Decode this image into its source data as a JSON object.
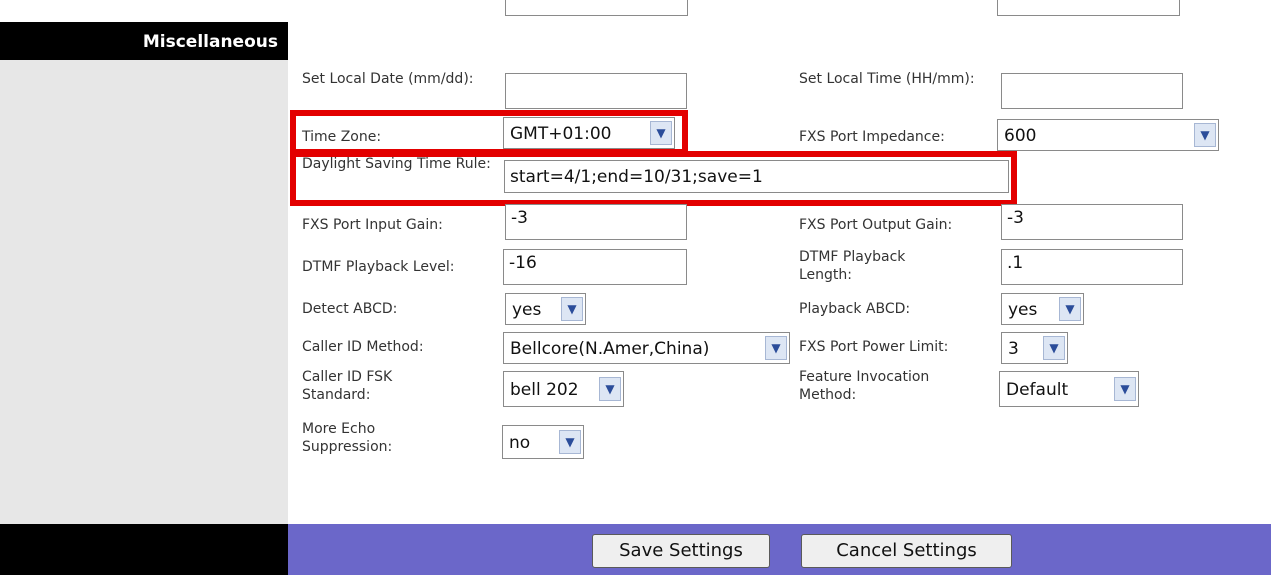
{
  "sidebar": {
    "section_title": "Miscellaneous"
  },
  "fields": {
    "set_local_date": {
      "label": "Set Local Date (mm/dd):",
      "value": ""
    },
    "set_local_time": {
      "label": "Set Local Time (HH/mm):",
      "value": ""
    },
    "time_zone": {
      "label": "Time Zone:",
      "value": "GMT+01:00"
    },
    "fxs_port_impedance": {
      "label": "FXS Port Impedance:",
      "value": "600"
    },
    "daylight_saving_time_rule": {
      "label": "Daylight Saving Time Rule:",
      "value": "start=4/1;end=10/31;save=1"
    },
    "fxs_port_input_gain": {
      "label": "FXS Port Input Gain:",
      "value": "-3"
    },
    "fxs_port_output_gain": {
      "label": "FXS Port Output Gain:",
      "value": "-3"
    },
    "dtmf_playback_level": {
      "label": "DTMF Playback Level:",
      "value": "-16"
    },
    "dtmf_playback_length": {
      "label": "DTMF Playback Length:",
      "value": ".1"
    },
    "detect_abcd": {
      "label": "Detect ABCD:",
      "value": "yes"
    },
    "playback_abcd": {
      "label": "Playback ABCD:",
      "value": "yes"
    },
    "caller_id_method": {
      "label": "Caller ID Method:",
      "value": "Bellcore(N.Amer,China)"
    },
    "fxs_port_power_limit": {
      "label": "FXS Port Power Limit:",
      "value": "3"
    },
    "caller_id_fsk_standard": {
      "label": "Caller ID FSK Standard:",
      "value": "bell 202"
    },
    "feature_invocation_method": {
      "label": "Feature Invocation Method:",
      "value": "Default"
    },
    "more_echo_suppression": {
      "label": "More Echo Suppression:",
      "value": "no"
    }
  },
  "buttons": {
    "save": "Save Settings",
    "cancel": "Cancel Settings"
  },
  "colors": {
    "highlight": "#e30000",
    "footer_bar": "#6b67c9",
    "sidebar_header": "#000000",
    "sidebar_panel": "#e7e7e7"
  },
  "icons": {
    "dropdown": "chevron-down-icon"
  }
}
